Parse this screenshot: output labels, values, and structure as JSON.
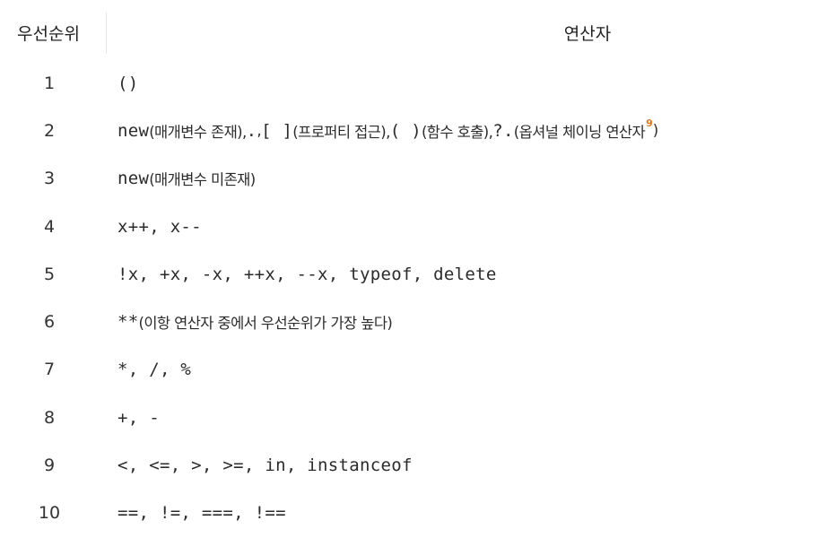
{
  "header": {
    "priority": "우선순위",
    "operator": "연산자"
  },
  "rows": [
    {
      "num": "1",
      "op": [
        "()"
      ]
    },
    {
      "num": "2",
      "op": [
        "new",
        "(매개변수 존재), ",
        ".",
        ", ",
        "[ ]",
        "(프로퍼티 접근), ",
        "( )",
        "(함수 호출), ",
        "?.",
        "(옵셔널 체이닝 연산자",
        "9",
        ")"
      ]
    },
    {
      "num": "3",
      "op": [
        "new",
        "(매개변수 미존재)"
      ]
    },
    {
      "num": "4",
      "op": [
        "x++, x--"
      ]
    },
    {
      "num": "5",
      "op": [
        "!x, +x, -x, ++x, --x, typeof, delete"
      ]
    },
    {
      "num": "6",
      "op": [
        "**",
        "(이항 연산자 중에서 우선순위가 가장 높다)"
      ]
    },
    {
      "num": "7",
      "op": [
        "*, /, %"
      ]
    },
    {
      "num": "8",
      "op": [
        "+, -"
      ]
    },
    {
      "num": "9",
      "op": [
        "<, <=, >, >=, in, instanceof"
      ]
    },
    {
      "num": "10",
      "op": [
        "==, !=, ===, !=="
      ]
    }
  ]
}
